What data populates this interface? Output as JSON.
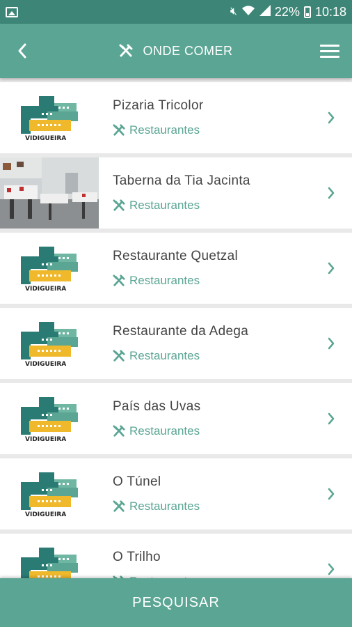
{
  "status_bar": {
    "battery": "22%",
    "time": "10:18"
  },
  "header": {
    "title": "ONDE COMER",
    "back_icon": "chevron-left-icon",
    "title_icon": "cutlery-icon",
    "menu_icon": "hamburger-menu-icon"
  },
  "logo_text": "VIDIGUEIRA",
  "items": [
    {
      "name": "Pizaria Tricolor",
      "category": "Restaurantes",
      "thumb": "logo"
    },
    {
      "name": "Taberna da Tia Jacinta",
      "category": "Restaurantes",
      "thumb": "photo"
    },
    {
      "name": "Restaurante Quetzal",
      "category": "Restaurantes",
      "thumb": "logo"
    },
    {
      "name": "Restaurante da Adega",
      "category": "Restaurantes",
      "thumb": "logo"
    },
    {
      "name": "País das Uvas",
      "category": "Restaurantes",
      "thumb": "logo"
    },
    {
      "name": "O Túnel",
      "category": "Restaurantes",
      "thumb": "logo"
    },
    {
      "name": "O Trilho",
      "category": "Restaurantes",
      "thumb": "logo"
    }
  ],
  "bottom_button": "PESQUISAR",
  "colors": {
    "status_bar": "#3d8677",
    "app_bar": "#5aa593",
    "accent": "#5aa593",
    "logo_dark": "#2a7b74",
    "logo_light": "#6fb7a3",
    "logo_yellow": "#f0b92c"
  }
}
